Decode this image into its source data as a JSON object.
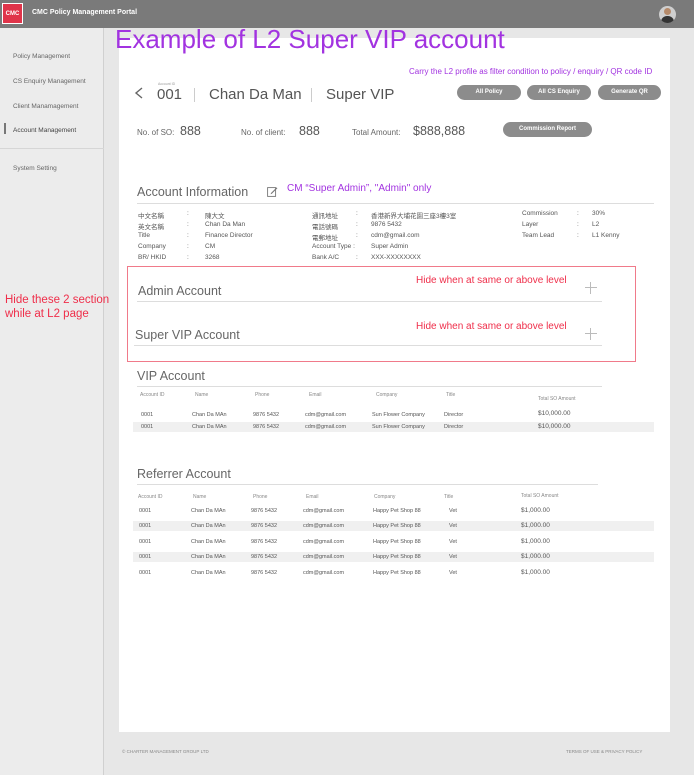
{
  "app": {
    "logo_text": "CMC",
    "title": "CMC Policy Management Portal"
  },
  "sidebar": {
    "items": [
      {
        "label": "Policy Management"
      },
      {
        "label": "CS Enquiry Management"
      },
      {
        "label": "Client Manamagement"
      },
      {
        "label": "Account Management"
      },
      {
        "label": "System Setting"
      }
    ],
    "active": "Account Management"
  },
  "annotations": {
    "title": "Example of L2 Super VIP account",
    "filter_note": "Carry the L2 profile as filter condition to policy / enquiry / QR code ID",
    "cm_note": "CM “Super Admin”, \"Admin\" only",
    "hide_sections": "Hide these 2 section while at L2 page",
    "hide_level_1": "Hide when at same or above level",
    "hide_level_2": "Hide when at same or above level"
  },
  "account_header": {
    "small_label": "Account ID",
    "account_no": "001",
    "name": "Chan Da Man",
    "level": "Super VIP"
  },
  "actions": {
    "all_policy": "All Policy",
    "all_cs_enquiry": "All CS Enquiry",
    "generate_qr": "Generate QR",
    "commission_report": "Commission Report"
  },
  "stats": {
    "so_label": "No. of SO:",
    "so_value": "888",
    "client_label": "No. of client:",
    "client_value": "888",
    "total_label": "Total Amount:",
    "total_value": "$888,888"
  },
  "account_info": {
    "title": "Account Information",
    "col1": [
      {
        "label": "中文名稱",
        "value": "陳大文"
      },
      {
        "label": "英文名稱",
        "value": "Chan Da Man"
      },
      {
        "label": "Title",
        "value": "Finance Director"
      },
      {
        "label": "Company",
        "value": "CM"
      },
      {
        "label": "BR/ HKID",
        "value": "3268"
      }
    ],
    "col2": [
      {
        "label": "通訊地址",
        "value": "香港新界大埔花園三座3樓3室"
      },
      {
        "label": "電話號碼",
        "value": "9876 5432"
      },
      {
        "label": "電郵地址",
        "value": "cdm@gmail.com"
      },
      {
        "label": "Account Type :",
        "value": "Super Admin"
      },
      {
        "label": "Bank A/C",
        "value": "XXX-XXXXXXXX"
      }
    ],
    "col3": [
      {
        "label": "Commission",
        "value": "30%"
      },
      {
        "label": "Layer",
        "value": "L2"
      },
      {
        "label": "Team Lead",
        "value": "L1 Kenny"
      }
    ],
    "colon": ":"
  },
  "admin_section": {
    "title": "Admin Account"
  },
  "super_vip_section": {
    "title": "Super VIP Account"
  },
  "vip_section": {
    "title": "VIP Account",
    "headers": [
      "Account ID",
      "Name",
      "Phone",
      "Email",
      "Company",
      "Title",
      "Total SO Amount"
    ],
    "rows": [
      [
        "0001",
        "Chan Da MAn",
        "9876 5432",
        "cdm@gmail.com",
        "Sun Flower Company",
        "Director",
        "$10,000.00"
      ],
      [
        "0001",
        "Chan Da MAn",
        "9876 5432",
        "cdm@gmail.com",
        "Sun Flower Company",
        "Director",
        "$10,000.00"
      ]
    ]
  },
  "referrer_section": {
    "title": "Referrer Account",
    "headers": [
      "Account ID",
      "Name",
      "Phone",
      "Email",
      "Company",
      "Title",
      "Total SO Amount"
    ],
    "rows": [
      [
        "0001",
        "Chan Da MAn",
        "9876 5432",
        "cdm@gmail.com",
        "Happy Pet Shop 88",
        "Vet",
        "$1,000.00"
      ],
      [
        "0001",
        "Chan Da MAn",
        "9876 5432",
        "cdm@gmail.com",
        "Happy Pet Shop 88",
        "Vet",
        "$1,000.00"
      ],
      [
        "0001",
        "Chan Da MAn",
        "9876 5432",
        "cdm@gmail.com",
        "Happy Pet Shop 88",
        "Vet",
        "$1,000.00"
      ],
      [
        "0001",
        "Chan Da MAn",
        "9876 5432",
        "cdm@gmail.com",
        "Happy Pet Shop 88",
        "Vet",
        "$1,000.00"
      ],
      [
        "0001",
        "Chan Da MAn",
        "9876 5432",
        "cdm@gmail.com",
        "Happy Pet Shop 88",
        "Vet",
        "$1,000.00"
      ]
    ]
  },
  "footer": {
    "copyright": "© CHARTER MANAGEMENT GROUP LTD",
    "links": "TERMS OF USE & PRIVACY POLICY"
  },
  "colors": {
    "annotation_purple": "#a233e0",
    "annotation_red": "#ef2e4a",
    "logo_red": "#e0344a"
  }
}
